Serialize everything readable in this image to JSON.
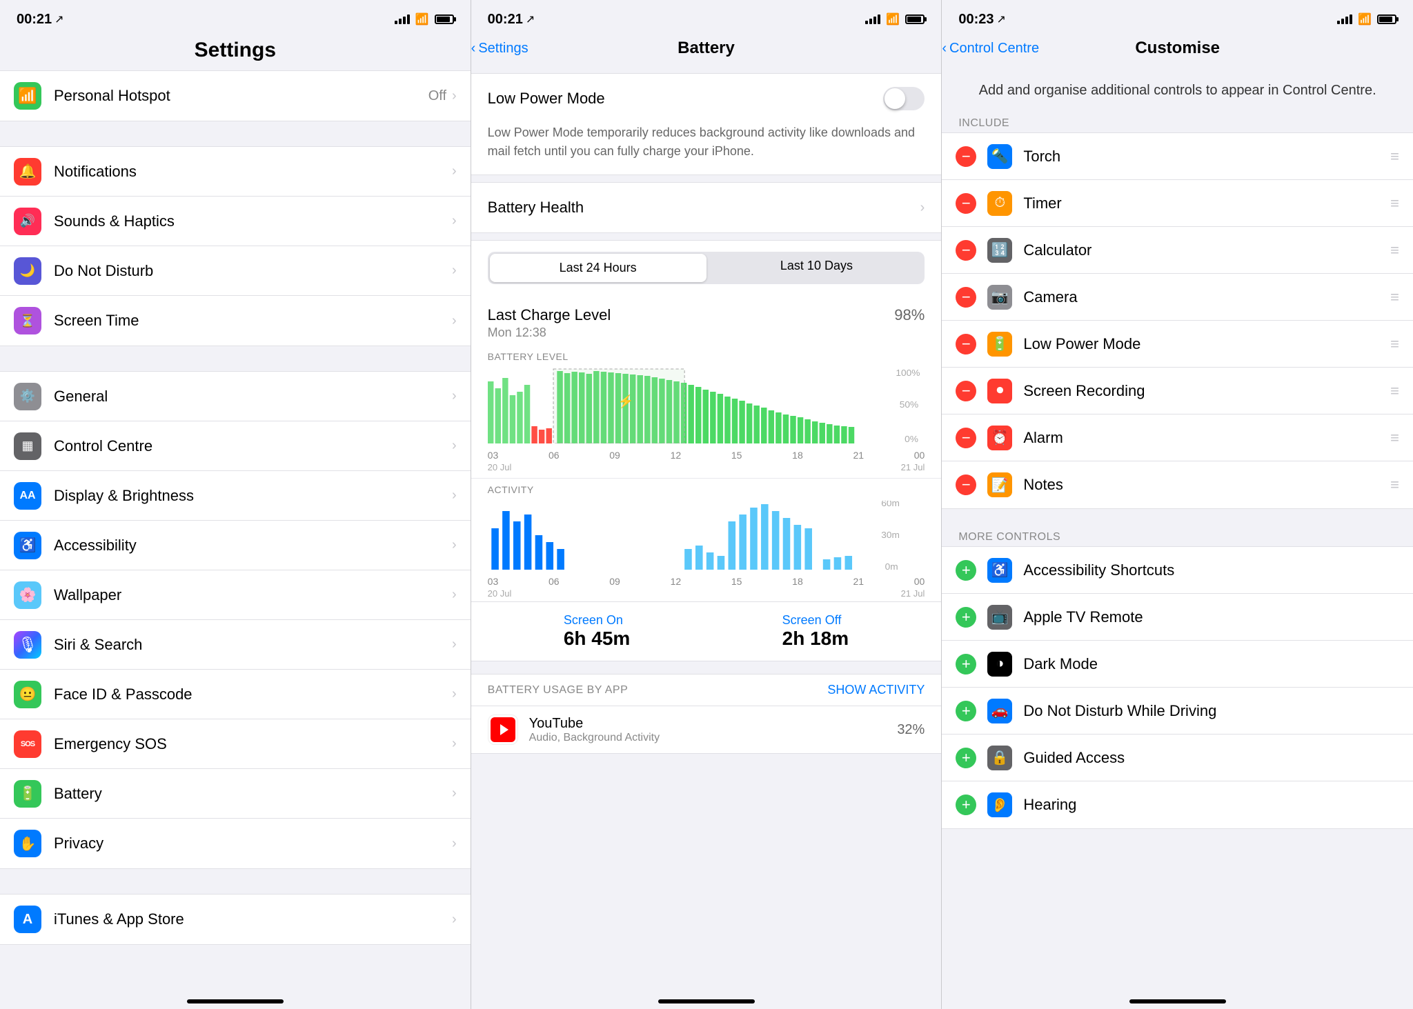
{
  "panel1": {
    "statusBar": {
      "time": "00:21",
      "locationIcon": "↗"
    },
    "title": "Settings",
    "topItem": {
      "label": "Personal Hotspot",
      "value": "Off",
      "iconBg": "#34c759",
      "iconChar": "📶"
    },
    "section1": [
      {
        "label": "Notifications",
        "iconBg": "#ff3b30",
        "iconChar": "🔔"
      },
      {
        "label": "Sounds & Haptics",
        "iconBg": "#ff2d55",
        "iconChar": "🔊"
      },
      {
        "label": "Do Not Disturb",
        "iconBg": "#5856d6",
        "iconChar": "🌙"
      },
      {
        "label": "Screen Time",
        "iconBg": "#af52de",
        "iconChar": "⏳"
      }
    ],
    "section2": [
      {
        "label": "General",
        "iconBg": "#8e8e93",
        "iconChar": "⚙️"
      },
      {
        "label": "Control Centre",
        "iconBg": "#636366",
        "iconChar": "🔲"
      },
      {
        "label": "Display & Brightness",
        "iconBg": "#007aff",
        "iconChar": "AA"
      },
      {
        "label": "Accessibility",
        "iconBg": "#007aff",
        "iconChar": "♿"
      },
      {
        "label": "Wallpaper",
        "iconBg": "#5ac8fa",
        "iconChar": "🌸"
      },
      {
        "label": "Siri & Search",
        "iconBg": "#000",
        "iconChar": "🎙"
      },
      {
        "label": "Face ID & Passcode",
        "iconBg": "#34c759",
        "iconChar": "😐"
      },
      {
        "label": "Emergency SOS",
        "iconBg": "#ff3b30",
        "iconChar": "SOS"
      },
      {
        "label": "Battery",
        "iconBg": "#34c759",
        "iconChar": "🔋"
      },
      {
        "label": "Privacy",
        "iconBg": "#007aff",
        "iconChar": "✋"
      }
    ],
    "section3": [
      {
        "label": "iTunes & App Store",
        "iconBg": "#007aff",
        "iconChar": "A"
      }
    ]
  },
  "panel2": {
    "statusBar": {
      "time": "00:21"
    },
    "backLabel": "Settings",
    "title": "Battery",
    "lowPowerMode": {
      "label": "Low Power Mode",
      "description": "Low Power Mode temporarily reduces background activity like downloads and mail fetch until you can fully charge your iPhone.",
      "isOn": false
    },
    "batteryHealth": {
      "label": "Battery Health"
    },
    "segments": [
      "Last 24 Hours",
      "Last 10 Days"
    ],
    "activeSegment": 0,
    "lastCharge": {
      "label": "Last Charge Level",
      "date": "Mon 12:38",
      "value": "98%"
    },
    "batteryLevelLabel": "BATTERY LEVEL",
    "activityLabel": "ACTIVITY",
    "chartYLabels": [
      "100%",
      "50%",
      "0%"
    ],
    "activityYLabels": [
      "60m",
      "30m",
      "0m"
    ],
    "xLabels": [
      "03",
      "06",
      "09",
      "12",
      "15",
      "18",
      "21",
      "00"
    ],
    "xDates": [
      "20 Jul",
      "",
      "",
      "",
      "",
      "",
      "",
      "21 Jul"
    ],
    "screenOn": {
      "label": "Screen On",
      "value": "6h 45m"
    },
    "screenOff": {
      "label": "Screen Off",
      "value": "2h 18m"
    },
    "usageByAppLabel": "BATTERY USAGE BY APP",
    "showActivity": "SHOW ACTIVITY",
    "apps": [
      {
        "name": "YouTube",
        "sub": "Audio, Background Activity",
        "pct": "32%",
        "color": "#ff0000",
        "icon": "▶"
      }
    ]
  },
  "panel3": {
    "statusBar": {
      "time": "00:23"
    },
    "backLabel": "Control Centre",
    "title": "Customise",
    "description": "Add and organise additional controls to appear in Control Centre.",
    "includeLabel": "INCLUDE",
    "moreControlsLabel": "MORE CONTROLS",
    "includeItems": [
      {
        "label": "Torch",
        "iconBg": "#007aff",
        "iconChar": "🔦"
      },
      {
        "label": "Timer",
        "iconBg": "#ff9500",
        "iconChar": "⏱"
      },
      {
        "label": "Calculator",
        "iconBg": "#636366",
        "iconChar": "🔢"
      },
      {
        "label": "Camera",
        "iconBg": "#8e8e93",
        "iconChar": "📷"
      },
      {
        "label": "Low Power Mode",
        "iconBg": "#ff9500",
        "iconChar": "🔋"
      },
      {
        "label": "Screen Recording",
        "iconBg": "#ff3b30",
        "iconChar": "⏺"
      },
      {
        "label": "Alarm",
        "iconBg": "#ff3b30",
        "iconChar": "⏰"
      },
      {
        "label": "Notes",
        "iconBg": "#ff9500",
        "iconChar": "📝"
      }
    ],
    "moreItems": [
      {
        "label": "Accessibility Shortcuts",
        "iconBg": "#007aff",
        "iconChar": "♿"
      },
      {
        "label": "Apple TV Remote",
        "iconBg": "#636366",
        "iconChar": "📺"
      },
      {
        "label": "Dark Mode",
        "iconBg": "#000",
        "iconChar": "◑"
      },
      {
        "label": "Do Not Disturb While Driving",
        "iconBg": "#007aff",
        "iconChar": "🚗"
      },
      {
        "label": "Guided Access",
        "iconBg": "#636366",
        "iconChar": "🔒"
      },
      {
        "label": "Hearing",
        "iconBg": "#007aff",
        "iconChar": "👂"
      }
    ]
  }
}
